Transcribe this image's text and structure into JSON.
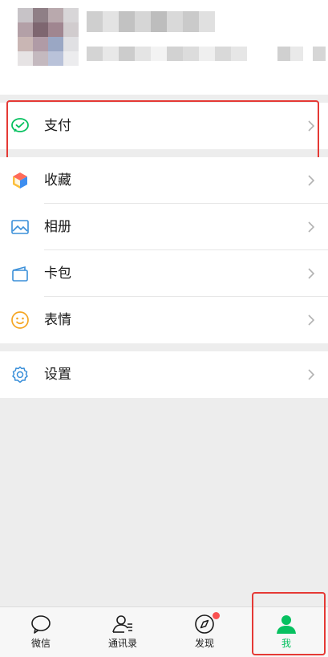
{
  "menu": {
    "pay": {
      "label": "支付",
      "icon": "wechat-pay-icon"
    },
    "items": [
      {
        "label": "收藏",
        "icon": "favorites-cube-icon"
      },
      {
        "label": "相册",
        "icon": "album-image-icon"
      },
      {
        "label": "卡包",
        "icon": "card-wallet-icon"
      },
      {
        "label": "表情",
        "icon": "smiley-icon"
      }
    ],
    "settings": {
      "label": "设置",
      "icon": "gear-icon"
    }
  },
  "tabs": [
    {
      "label": "微信",
      "icon": "chat-bubble-icon"
    },
    {
      "label": "通讯录",
      "icon": "contacts-icon"
    },
    {
      "label": "发现",
      "icon": "compass-icon",
      "badge": true
    },
    {
      "label": "我",
      "icon": "person-icon",
      "active": true
    }
  ],
  "colors": {
    "accent": "#07c160",
    "highlight": "#e53935",
    "badge": "#fa5151"
  }
}
